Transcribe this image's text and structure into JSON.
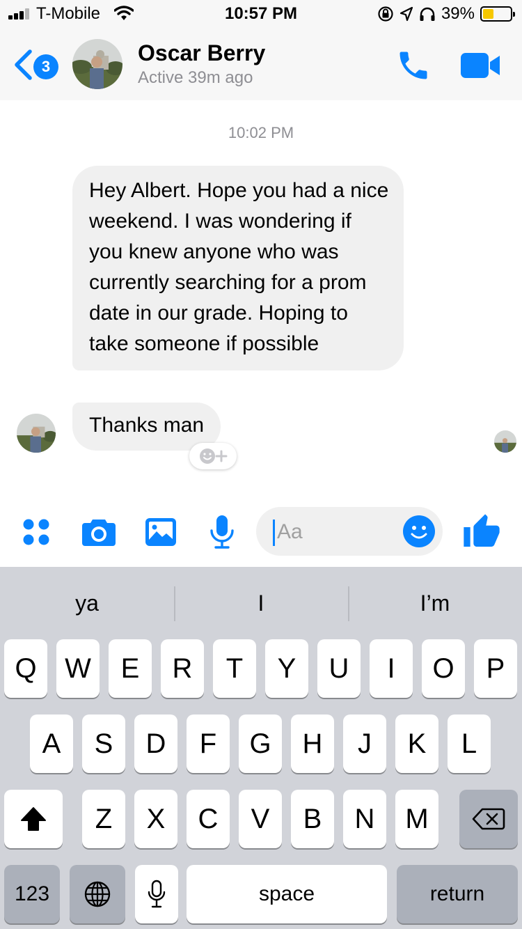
{
  "status_bar": {
    "carrier": "T-Mobile",
    "time": "10:57 PM",
    "battery_percent": "39%",
    "battery_level": 0.39,
    "icons": [
      "signal-icon",
      "wifi-icon",
      "rotation-lock-icon",
      "location-arrow-icon",
      "headphones-icon",
      "battery-icon"
    ]
  },
  "header": {
    "back_badge": "3",
    "contact_name": "Oscar Berry",
    "active_status": "Active 39m ago",
    "icons": [
      "back-chevron-icon",
      "avatar",
      "phone-icon",
      "video-camera-icon"
    ]
  },
  "conversation": {
    "timestamp": "10:02 PM",
    "messages": [
      "Hey Albert. Hope you had a nice weekend. I was wondering if you knew anyone who was currently searching for a prom date in our grade. Hoping to take someone if possible",
      "Thanks man"
    ]
  },
  "composer": {
    "placeholder": "Aa",
    "icons": [
      "apps-grid-icon",
      "camera-icon",
      "photo-icon",
      "microphone-icon",
      "emoji-icon",
      "thumbs-up-icon"
    ]
  },
  "keyboard": {
    "suggestions": [
      "ya",
      "I",
      "I’m"
    ],
    "row1": [
      "Q",
      "W",
      "E",
      "R",
      "T",
      "Y",
      "U",
      "I",
      "O",
      "P"
    ],
    "row2": [
      "A",
      "S",
      "D",
      "F",
      "G",
      "H",
      "J",
      "K",
      "L"
    ],
    "row3": [
      "Z",
      "X",
      "C",
      "V",
      "B",
      "N",
      "M"
    ],
    "numbers_key": "123",
    "space_key": "space",
    "return_key": "return"
  },
  "colors": {
    "accent": "#0a84ff",
    "bubble_incoming": "#f0f0f0",
    "secondary_text": "#8e8e93",
    "battery_fill": "#f7c800",
    "keyboard_bg": "#d1d3d9"
  }
}
